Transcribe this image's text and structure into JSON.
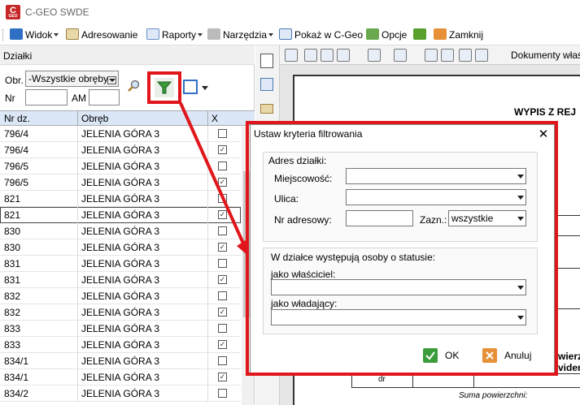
{
  "app": {
    "title": "C-GEO SWDE",
    "icon_text": "C",
    "icon_sub": "GEO"
  },
  "menu": [
    {
      "label": "Widok",
      "dropdown": true,
      "icon": "view-icon",
      "color": "#2f6fc4"
    },
    {
      "label": "Adresowanie",
      "dropdown": false,
      "icon": "envelope-icon",
      "color": "#d8b25a"
    },
    {
      "label": "Raporty",
      "dropdown": true,
      "icon": "report-icon",
      "color": "#6a8fc8"
    },
    {
      "label": "Narzędzia",
      "dropdown": true,
      "icon": "tools-icon",
      "color": "#8a8a8a"
    },
    {
      "label": "Pokaż w C-Geo",
      "dropdown": false,
      "icon": "show-map-icon",
      "color": "#4d79b8"
    },
    {
      "label": "Opcje",
      "dropdown": false,
      "icon": "options-icon",
      "color": "#6aa84f"
    },
    {
      "label": "",
      "dropdown": false,
      "icon": "android-icon",
      "color": "#5aa02c"
    },
    {
      "label": "Zamknij",
      "dropdown": false,
      "icon": "close-app-icon",
      "color": "#e69138"
    }
  ],
  "left": {
    "header": "Działki",
    "obr_label": "Obr.",
    "obr_value": "-Wszystkie obręby",
    "nr_label": "Nr",
    "am_label": "AM",
    "nr_value": "",
    "am_value": "",
    "columns": [
      "Nr dz.",
      "Obręb",
      "X"
    ],
    "rows": [
      {
        "nr": "796/4",
        "obreb": "JELENIA GÓRA 3",
        "x": false
      },
      {
        "nr": "796/4",
        "obreb": "JELENIA GÓRA 3",
        "x": true
      },
      {
        "nr": "796/5",
        "obreb": "JELENIA GÓRA 3",
        "x": false
      },
      {
        "nr": "796/5",
        "obreb": "JELENIA GÓRA 3",
        "x": true
      },
      {
        "nr": "821",
        "obreb": "JELENIA GÓRA 3",
        "x": false
      },
      {
        "nr": "821",
        "obreb": "JELENIA GÓRA 3",
        "x": true
      },
      {
        "nr": "830",
        "obreb": "JELENIA GÓRA 3",
        "x": false
      },
      {
        "nr": "830",
        "obreb": "JELENIA GÓRA 3",
        "x": true
      },
      {
        "nr": "831",
        "obreb": "JELENIA GÓRA 3",
        "x": false
      },
      {
        "nr": "831",
        "obreb": "JELENIA GÓRA 3",
        "x": true
      },
      {
        "nr": "832",
        "obreb": "JELENIA GÓRA 3",
        "x": false
      },
      {
        "nr": "832",
        "obreb": "JELENIA GÓRA 3",
        "x": true
      },
      {
        "nr": "833",
        "obreb": "JELENIA GÓRA 3",
        "x": false
      },
      {
        "nr": "833",
        "obreb": "JELENIA GÓRA 3",
        "x": true
      },
      {
        "nr": "834/1",
        "obreb": "JELENIA GÓRA 3",
        "x": false
      },
      {
        "nr": "834/1",
        "obreb": "JELENIA GÓRA 3",
        "x": true
      },
      {
        "nr": "834/2",
        "obreb": "JELENIA GÓRA 3",
        "x": false
      }
    ]
  },
  "right": {
    "toolbar_text": "Dokumenty właś",
    "doc_title": "WYPIS Z REJ",
    "doc_cell1": "dr",
    "doc_footer": "Suma powierzchni:",
    "doc_side1": "wierz",
    "doc_side2": "viden"
  },
  "dialog": {
    "title": "Ustaw kryteria filtrowania",
    "group1": "Adres działki:",
    "miejscowosc_label": "Miejscowość:",
    "ulica_label": "Ulica:",
    "nr_adresowy_label": "Nr adresowy:",
    "zazn_label": "Zazn.:",
    "zazn_value": "wszystkie",
    "group2": "W działce występują osoby o statusie:",
    "wlasciciel_label": "jako właściciel:",
    "wladajacy_label": "jako władający:",
    "ok_label": "OK",
    "cancel_label": "Anuluj"
  },
  "colors": {
    "highlight": "#e0161b",
    "filter_icon": "#3a9a3a",
    "ok": "#3b9c3b",
    "cancel": "#e69138"
  }
}
